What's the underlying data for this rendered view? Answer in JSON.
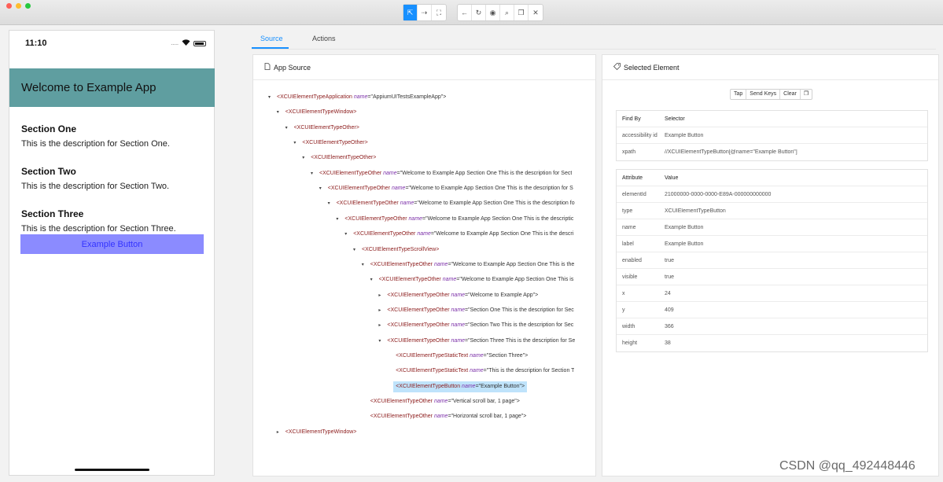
{
  "toolbar": {
    "buttons": [
      {
        "name": "select-elements",
        "icon": "cursor-icon",
        "glyph": "⇱"
      },
      {
        "name": "swipe-by-coordinates",
        "icon": "swipe-icon",
        "glyph": "⇢"
      },
      {
        "name": "tap-by-coordinates",
        "icon": "crop-icon",
        "glyph": "⛶"
      },
      {
        "name": "back",
        "icon": "arrow-left-icon",
        "glyph": "←"
      },
      {
        "name": "refresh",
        "icon": "refresh-icon",
        "glyph": "↻"
      },
      {
        "name": "start-recording",
        "icon": "eye-icon",
        "glyph": "◉"
      },
      {
        "name": "search",
        "icon": "search-icon",
        "glyph": "⌕"
      },
      {
        "name": "copy-xml",
        "icon": "copy-icon",
        "glyph": "❐"
      },
      {
        "name": "quit",
        "icon": "close-icon",
        "glyph": "✕"
      }
    ]
  },
  "phone": {
    "time": "11:10",
    "signal": ".....",
    "header_title": "Welcome to Example App",
    "sections": [
      {
        "title": "Section One",
        "description": "This is the description for Section One."
      },
      {
        "title": "Section Two",
        "description": "This is the description for Section Two."
      },
      {
        "title": "Section Three",
        "description": "This is the description for Section Three."
      }
    ],
    "button_label": "Example Button"
  },
  "tabs": [
    {
      "label": "Source",
      "active": true
    },
    {
      "label": "Actions",
      "active": false
    }
  ],
  "source_panel": {
    "title": "App Source",
    "tree": [
      {
        "arrow": "▾",
        "tag": "<XCUIElementTypeApplication",
        "attr": "name",
        "value": "=\"AppiumUITestsExampleApp\">"
      },
      {
        "arrow": "▾",
        "tag": "<XCUIElementTypeWindow>",
        "attr": "",
        "value": ""
      },
      {
        "arrow": "▾",
        "tag": "<XCUIElementTypeOther>",
        "attr": "",
        "value": ""
      },
      {
        "arrow": "▾",
        "tag": "<XCUIElementTypeOther>",
        "attr": "",
        "value": ""
      },
      {
        "arrow": "▾",
        "tag": "<XCUIElementTypeOther>",
        "attr": "",
        "value": ""
      },
      {
        "arrow": "▾",
        "tag": "<XCUIElementTypeOther",
        "attr": "name",
        "value": "=\"Welcome to Example App Section One This is the description for Sect"
      },
      {
        "arrow": "▾",
        "tag": "<XCUIElementTypeOther",
        "attr": "name",
        "value": "=\"Welcome to Example App Section One This is the description for S"
      },
      {
        "arrow": "▾",
        "tag": "<XCUIElementTypeOther",
        "attr": "name",
        "value": "=\"Welcome to Example App Section One This is the description fo"
      },
      {
        "arrow": "▾",
        "tag": "<XCUIElementTypeOther",
        "attr": "name",
        "value": "=\"Welcome to Example App Section One This is the descriptic"
      },
      {
        "arrow": "▾",
        "tag": "<XCUIElementTypeOther",
        "attr": "name",
        "value": "=\"Welcome to Example App Section One This is the descri"
      },
      {
        "arrow": "▾",
        "tag": "<XCUIElementTypeScrollView>",
        "attr": "",
        "value": ""
      },
      {
        "arrow": "▾",
        "tag": "<XCUIElementTypeOther",
        "attr": "name",
        "value": "=\"Welcome to Example App Section One This is the"
      },
      {
        "arrow": "▾",
        "tag": "<XCUIElementTypeOther",
        "attr": "name",
        "value": "=\"Welcome to Example App Section One This is"
      },
      {
        "arrow": "▸",
        "tag": "<XCUIElementTypeOther",
        "attr": "name",
        "value": "=\"Welcome to Example App\">"
      },
      {
        "arrow": "▸",
        "tag": "<XCUIElementTypeOther",
        "attr": "name",
        "value": "=\"Section One This is the description for Sec"
      },
      {
        "arrow": "▸",
        "tag": "<XCUIElementTypeOther",
        "attr": "name",
        "value": "=\"Section Two This is the description for Sec"
      },
      {
        "arrow": "▾",
        "tag": "<XCUIElementTypeOther",
        "attr": "name",
        "value": "=\"Section Three This is the description for Se"
      },
      {
        "arrow": "",
        "tag": "<XCUIElementTypeStaticText",
        "attr": "name",
        "value": "=\"Section Three\">"
      },
      {
        "arrow": "",
        "tag": "<XCUIElementTypeStaticText",
        "attr": "name",
        "value": "=\"This is the description for Section T"
      },
      {
        "arrow": "",
        "tag": "<XCUIElementTypeButton",
        "attr": "name",
        "value": "=\"Example Button\">",
        "selected": true
      },
      {
        "arrow": "",
        "tag": "<XCUIElementTypeOther",
        "attr": "name",
        "value": "=\"Vertical scroll bar, 1 page\">"
      },
      {
        "arrow": "",
        "tag": "<XCUIElementTypeOther",
        "attr": "name",
        "value": "=\"Horizontal scroll bar, 1 page\">"
      },
      {
        "arrow": "▸",
        "tag": "<XCUIElementTypeWindow>",
        "attr": "",
        "value": ""
      }
    ]
  },
  "selected_panel": {
    "title": "Selected Element",
    "actions": [
      "Tap",
      "Send Keys",
      "Clear",
      "❐"
    ],
    "find_by_header": [
      "Find By",
      "Selector"
    ],
    "find_by": [
      [
        "accessibility id",
        "Example Button"
      ],
      [
        "xpath",
        "//XCUIElementTypeButton[@name=\"Example Button\"]"
      ]
    ],
    "attr_header": [
      "Attribute",
      "Value"
    ],
    "attributes": [
      [
        "elementId",
        "21000000-0000-0000-E89A-000000000000"
      ],
      [
        "type",
        "XCUIElementTypeButton"
      ],
      [
        "name",
        "Example Button"
      ],
      [
        "label",
        "Example Button"
      ],
      [
        "enabled",
        "true"
      ],
      [
        "visible",
        "true"
      ],
      [
        "x",
        "24"
      ],
      [
        "y",
        "409"
      ],
      [
        "width",
        "366"
      ],
      [
        "height",
        "38"
      ]
    ]
  },
  "watermark": "CSDN @qq_492448446",
  "colors": {
    "accent": "#1890ff",
    "phone_header": "#5f9ea0",
    "phone_button": "#8b8bff",
    "selected_row": "#bfe3fb"
  }
}
